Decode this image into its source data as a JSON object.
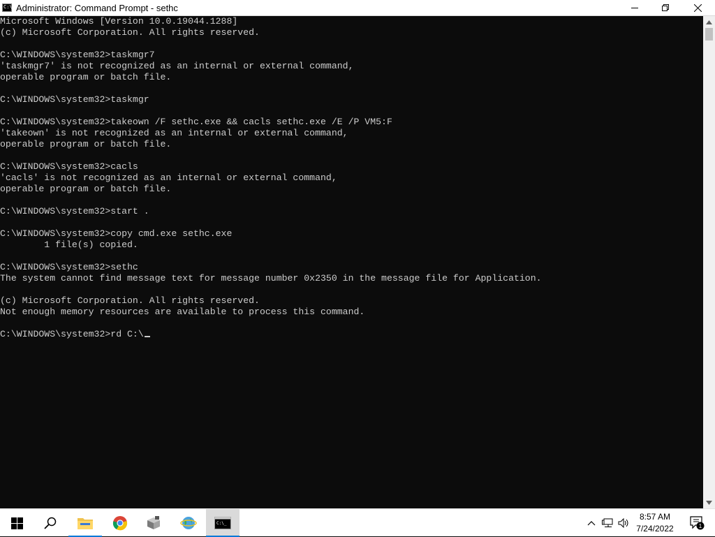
{
  "window": {
    "title": "Administrator: Command Prompt - sethc",
    "icon": "cmd-icon",
    "prompt_glyph": "C:\\"
  },
  "console": {
    "lines": [
      "Microsoft Windows [Version 10.0.19044.1288]",
      "(c) Microsoft Corporation. All rights reserved.",
      "",
      "C:\\WINDOWS\\system32>taskmgr7",
      "'taskmgr7' is not recognized as an internal or external command,",
      "operable program or batch file.",
      "",
      "C:\\WINDOWS\\system32>taskmgr",
      "",
      "C:\\WINDOWS\\system32>takeown /F sethc.exe && cacls sethc.exe /E /P VM5:F",
      "'takeown' is not recognized as an internal or external command,",
      "operable program or batch file.",
      "",
      "C:\\WINDOWS\\system32>cacls",
      "'cacls' is not recognized as an internal or external command,",
      "operable program or batch file.",
      "",
      "C:\\WINDOWS\\system32>start .",
      "",
      "C:\\WINDOWS\\system32>copy cmd.exe sethc.exe",
      "        1 file(s) copied.",
      "",
      "C:\\WINDOWS\\system32>sethc",
      "The system cannot find message text for message number 0x2350 in the message file for Application.",
      "",
      "(c) Microsoft Corporation. All rights reserved.",
      "Not enough memory resources are available to process this command.",
      ""
    ],
    "current_input": "C:\\WINDOWS\\system32>rd C:\\"
  },
  "taskbar": {
    "items": [
      {
        "name": "start-button",
        "icon": "windows-logo-icon"
      },
      {
        "name": "search-button",
        "icon": "search-icon"
      },
      {
        "name": "file-explorer",
        "icon": "folder-icon"
      },
      {
        "name": "chrome",
        "icon": "chrome-icon"
      },
      {
        "name": "app-installer",
        "icon": "package-icon"
      },
      {
        "name": "network-app",
        "icon": "globe-icon"
      },
      {
        "name": "command-prompt",
        "icon": "terminal-icon"
      }
    ],
    "tray": {
      "time": "8:57 AM",
      "date": "7/24/2022",
      "notification_count": "1"
    }
  },
  "colors": {
    "console_bg": "#0c0c0c",
    "console_text": "#cccccc",
    "accent": "#0078d7"
  }
}
